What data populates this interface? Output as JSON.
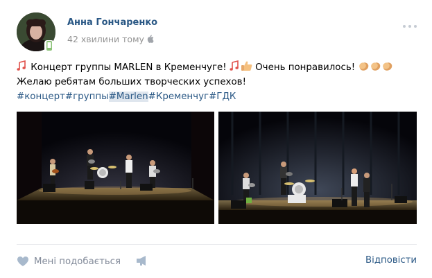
{
  "author": {
    "name": "Анна Гончаренко",
    "time": "42 хвилини тому",
    "avatar_icon": "user-avatar",
    "device_icon": "mobile-icon",
    "platform_icon": "apple-icon"
  },
  "post": {
    "line1": {
      "text_a": "Концерт группы MARLEN в Кременчуге!",
      "text_b": "Очень понравилось!"
    },
    "line2": "Желаю ребятам больших творческих успехов!",
    "hashtags": [
      "#концерт",
      "#группы",
      "#Marlen",
      "#Кременчуг",
      "#ГДК"
    ],
    "emoji": [
      "musical-notes-icon",
      "musical-notes-icon",
      "thumbs-up-icon",
      "clapping-hands-icon",
      "clapping-hands-icon",
      "clapping-hands-icon"
    ]
  },
  "photos": [
    {
      "name": "concert-photo-1"
    },
    {
      "name": "concert-photo-2"
    }
  ],
  "footer": {
    "like_label": "Мені подобається",
    "reply_label": "Відповісти"
  },
  "colors": {
    "link": "#2a5885",
    "muted": "#939393",
    "footer_text": "#828a99"
  }
}
